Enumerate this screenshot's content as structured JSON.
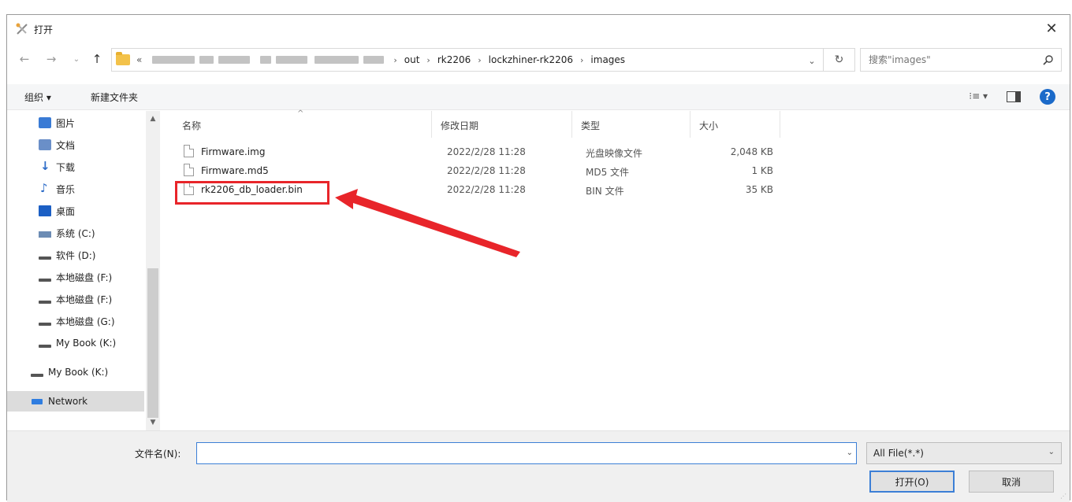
{
  "window": {
    "title": "打开",
    "close_glyph": "✕"
  },
  "nav": {
    "back_glyph": "←",
    "forward_glyph": "→",
    "history_glyph": "⌄",
    "up_glyph": "↑",
    "breadcrumb_prefix": "«",
    "breadcrumbs": [
      "out",
      "rk2206",
      "lockzhiner-rk2206",
      "images"
    ],
    "sep_glyph": "›",
    "dropdown_glyph": "⌄",
    "refresh_glyph": "↻"
  },
  "search": {
    "placeholder": "搜索\"images\""
  },
  "toolbar": {
    "organize": "组织 ▾",
    "new_folder": "新建文件夹",
    "view_glyph": "⁝≡ ▾",
    "help_glyph": "?"
  },
  "sidebar": {
    "items": [
      {
        "label": "图片",
        "icon": "pictures-icon"
      },
      {
        "label": "文档",
        "icon": "documents-icon"
      },
      {
        "label": "下载",
        "icon": "downloads-icon"
      },
      {
        "label": "音乐",
        "icon": "music-icon"
      },
      {
        "label": "桌面",
        "icon": "desktop-icon"
      },
      {
        "label": "系统 (C:)",
        "icon": "system-drive-icon"
      },
      {
        "label": "软件 (D:)",
        "icon": "drive-icon"
      },
      {
        "label": "本地磁盘 (F:)",
        "icon": "drive-icon"
      },
      {
        "label": "本地磁盘 (F:)",
        "icon": "drive-icon"
      },
      {
        "label": "本地磁盘 (G:)",
        "icon": "drive-icon"
      },
      {
        "label": "My Book (K:)",
        "icon": "drive-icon"
      },
      {
        "label": "My Book (K:)",
        "icon": "drive-icon"
      },
      {
        "label": "Network",
        "icon": "network-icon"
      }
    ],
    "scroll_up": "▲",
    "scroll_down": "▼"
  },
  "columns": {
    "name": "名称",
    "date": "修改日期",
    "type": "类型",
    "size": "大小",
    "sort_glyph": "^"
  },
  "files": [
    {
      "name": "Firmware.img",
      "date": "2022/2/28 11:28",
      "type": "光盘映像文件",
      "size": "2,048 KB"
    },
    {
      "name": "Firmware.md5",
      "date": "2022/2/28 11:28",
      "type": "MD5 文件",
      "size": "1 KB"
    },
    {
      "name": "rk2206_db_loader.bin",
      "date": "2022/2/28 11:28",
      "type": "BIN 文件",
      "size": "35 KB"
    }
  ],
  "bottom": {
    "filename_label": "文件名(N):",
    "filename_value": "",
    "filename_dd": "⌄",
    "filter_value": "All File(*.*)",
    "filter_dd": "⌄",
    "open_label": "打开(O)",
    "cancel_label": "取消"
  },
  "colors": {
    "annotation": "#e8252a",
    "accent": "#3c7fd6"
  }
}
